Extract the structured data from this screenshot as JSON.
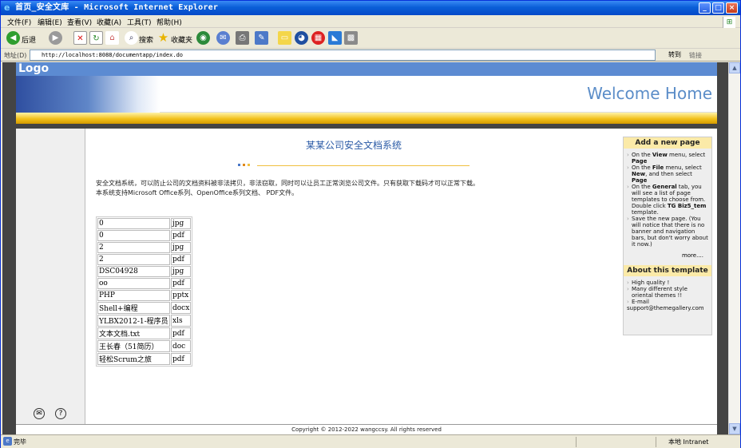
{
  "window": {
    "title": "首页_安全文库 - Microsoft Internet Explorer",
    "minimize": "_",
    "maximize": "□",
    "close": "×"
  },
  "menu": [
    {
      "label": "文件(F)"
    },
    {
      "label": "编辑(E)"
    },
    {
      "label": "查看(V)"
    },
    {
      "label": "收藏(A)"
    },
    {
      "label": "工具(T)"
    },
    {
      "label": "帮助(H)"
    }
  ],
  "toolbar": {
    "back": "后退",
    "search": "搜索",
    "favorites": "收藏夹"
  },
  "address": {
    "label": "地址(D)",
    "url": "http://localhost:8088/documentapp/index.do",
    "go": "转到",
    "links": "链接"
  },
  "site": {
    "logo": "Logo",
    "welcome": "Welcome Home",
    "heading": "某某公司安全文档系统",
    "intro1": "安全文档系统，可以防止公司的文档资料被非法拷贝，非法窃取，同时可以让员工正常浏览公司文件。只有获取下载码才可以正常下载。",
    "intro2": "本系统支持Microsoft Office系列、OpenOffice系列文档、 PDF文件。",
    "footer": "Copyright © 2012-2022 wangccsy. All rights reserved"
  },
  "files": [
    {
      "name": "0",
      "ext": "jpg"
    },
    {
      "name": "0",
      "ext": "pdf"
    },
    {
      "name": "2",
      "ext": "jpg"
    },
    {
      "name": "2",
      "ext": "pdf"
    },
    {
      "name": "DSC04928",
      "ext": "jpg"
    },
    {
      "name": "oo",
      "ext": "pdf"
    },
    {
      "name": "PHP",
      "ext": "pptx"
    },
    {
      "name": "Shell+编程",
      "ext": "docx"
    },
    {
      "name": "YLBX2012-1-程序员",
      "ext": "xls"
    },
    {
      "name": "文本文档.txt",
      "ext": "pdf"
    },
    {
      "name": "王长春（51简历）",
      "ext": "doc"
    },
    {
      "name": "轻松Scrum之旅",
      "ext": "pdf"
    }
  ],
  "sidebar": {
    "box1_title": "Add a new page",
    "box1_more": "more....",
    "box2_title": "About this template",
    "box2_items": [
      "High quality !",
      "Many different style oriental themes !!",
      "E-mail"
    ],
    "email": "support@themegallery.com"
  },
  "status": {
    "text": "完毕",
    "zone": "本地 Intranet"
  },
  "colors": {
    "titlebar": "#0a5fd8",
    "logo_bar": "#5c8bd2",
    "heading": "#2a5aa6",
    "gold": "#f2c11c"
  }
}
